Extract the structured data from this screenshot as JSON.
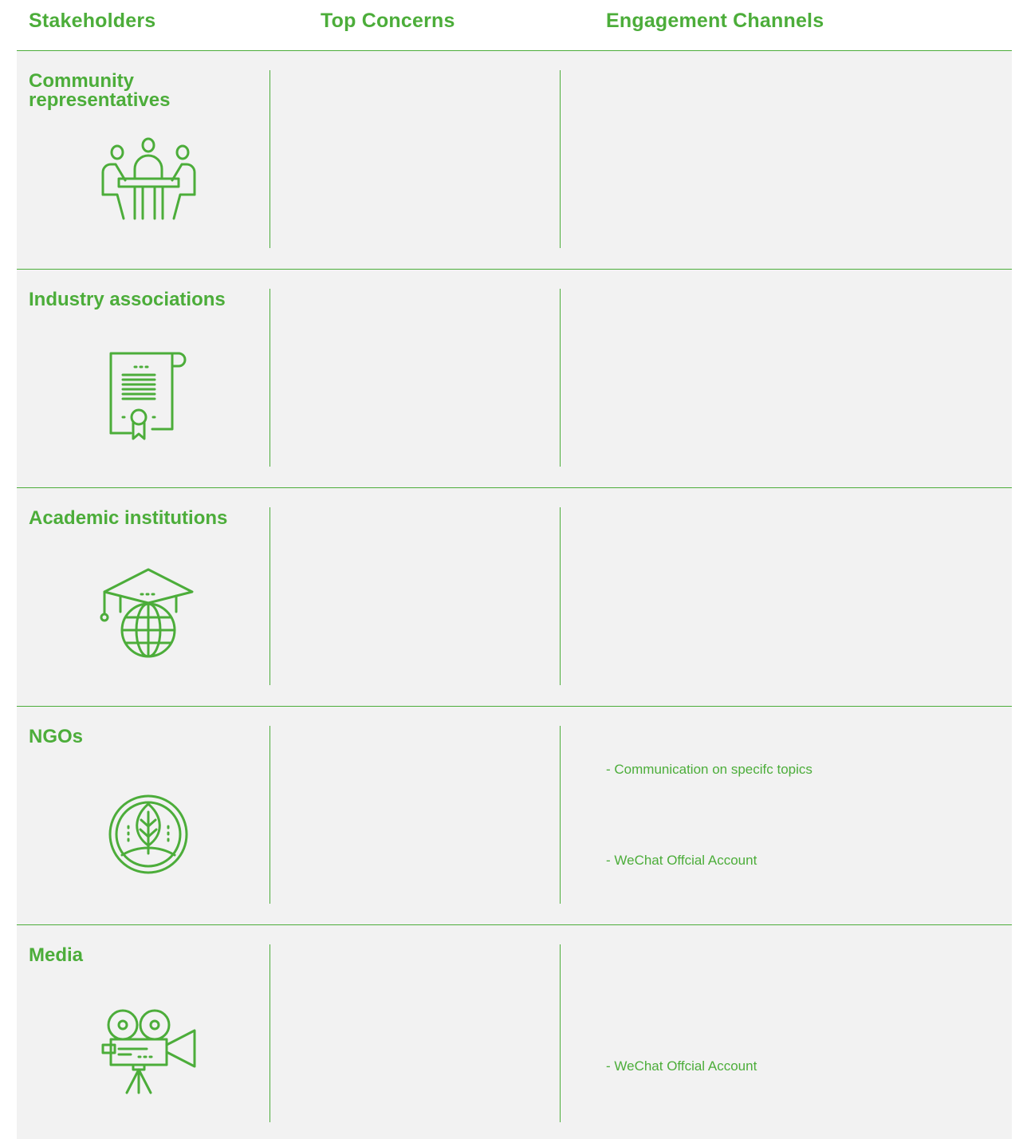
{
  "header": {
    "col1": "Stakeholders",
    "col2": "Top Concerns",
    "col3": "Engagement Channels"
  },
  "rows": [
    {
      "name": "Community representatives",
      "icon": "meeting-table-icon",
      "channels": []
    },
    {
      "name": "Industry associations",
      "icon": "certificate-scroll-icon",
      "channels": []
    },
    {
      "name": "Academic institutions",
      "icon": "graduation-globe-icon",
      "channels": []
    },
    {
      "name": "NGOs",
      "icon": "leaf-badge-icon",
      "channels": [
        "- Communication on specifc topics",
        "- WeChat Offcial Account"
      ]
    },
    {
      "name": "Media",
      "icon": "movie-camera-icon",
      "channels": [
        "- WeChat Offcial Account"
      ]
    }
  ],
  "colors": {
    "accent": "#4cad3a",
    "row_bg": "#f2f2f2"
  }
}
